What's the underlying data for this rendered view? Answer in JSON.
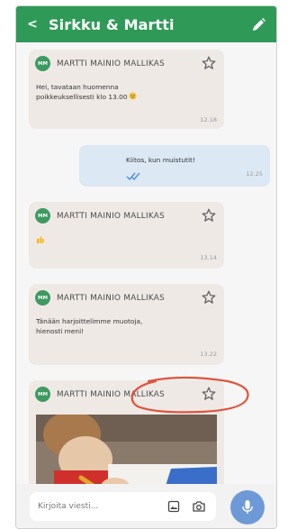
{
  "header": {
    "back_glyph": "<",
    "title": "Sirkku & Martti",
    "edit_icon": "pencil-icon",
    "color": "#2f9a57"
  },
  "messages": [
    {
      "sender": "MARTTI MAINIO MALLIKAS",
      "initials": "MM",
      "text_line1": "Hei, tavataan huomenna",
      "text_line2": "poikkeuksellisesti klo 13.00",
      "emoji": "smile-emoji",
      "time": "12.18"
    },
    {
      "text": "Kiitos, kun muistutit!",
      "time": "12.25",
      "status": "read-checkmarks"
    },
    {
      "sender": "MARTTI MAINIO MALLIKAS",
      "initials": "MM",
      "emoji": "thumbs-up",
      "time": "13.14"
    },
    {
      "sender": "MARTTI MAINIO MALLIKAS",
      "initials": "MM",
      "text_line1": "Tänään harjoittelimme muotoja,",
      "text_line2": "hienosti meni!",
      "time": "13.22"
    },
    {
      "sender": "MARTTI MAINIO MALLIKAS",
      "initials": "MM",
      "attachment": "photo-child-drawing"
    }
  ],
  "input": {
    "placeholder": "Kirjoita viesti..."
  },
  "colors": {
    "accent": "#2f9a57",
    "mic": "#6d9ad6",
    "incoming_bubble": "#efe9e6",
    "outgoing_bubble": "#dce8f4",
    "highlight": "#e0533a"
  }
}
